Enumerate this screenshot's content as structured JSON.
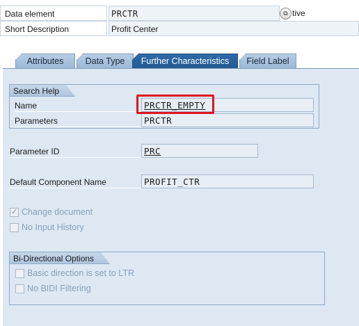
{
  "header": {
    "data_element_label": "Data element",
    "data_element_value": "PRCTR",
    "status_text_fragment": "tive",
    "short_description_label": "Short Description",
    "short_description_value": "Profit Center"
  },
  "tabs": [
    {
      "label": "Attributes",
      "active": false
    },
    {
      "label": "Data Type",
      "active": false
    },
    {
      "label": "Further Characteristics",
      "active": true
    },
    {
      "label": "Field Label",
      "active": false
    }
  ],
  "search_help": {
    "title": "Search Help",
    "name_label": "Name",
    "name_value": "PRCTR_EMPTY",
    "parameters_label": "Parameters",
    "parameters_value": "PRCTR"
  },
  "parameter_id": {
    "label": "Parameter ID",
    "value": "PRC"
  },
  "default_component": {
    "label": "Default Component Name",
    "value": "PROFIT_CTR"
  },
  "checkboxes": {
    "change_document": {
      "label": "Change document",
      "checked": true
    },
    "no_input_history": {
      "label": "No Input History",
      "checked": false
    }
  },
  "bidi": {
    "title": "Bi-Directional Options",
    "basic_direction": {
      "label": "Basic direction is set to LTR",
      "checked": false
    },
    "no_bidi_filtering": {
      "label": "No BIDI Filtering",
      "checked": false
    }
  },
  "icons": {
    "f4_help": "value-help-icon",
    "checkmark": "✓"
  },
  "colors": {
    "active_tab": "#2f6aa8",
    "panel_bg": "#dde8f3",
    "highlight": "#e0141e"
  }
}
